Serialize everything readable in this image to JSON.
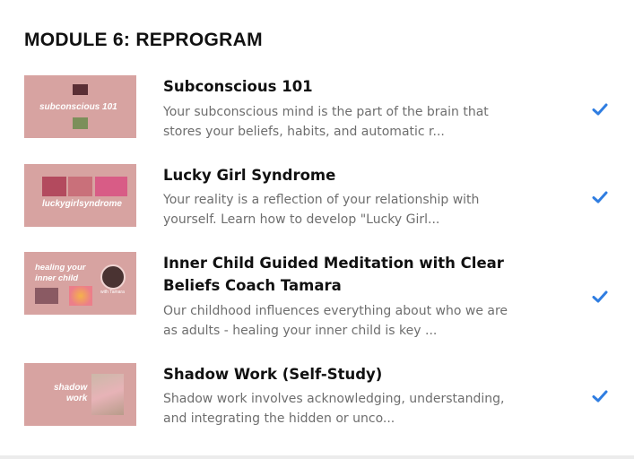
{
  "module": {
    "title": "MODULE 6: REPROGRAM"
  },
  "lessons": [
    {
      "title": "Subconscious 101",
      "description": "Your subconscious mind is the part of the brain that stores your beliefs, habits, and automatic r...",
      "thumbnail_caption": "subconscious 101",
      "completed": true
    },
    {
      "title": "Lucky Girl Syndrome",
      "description": "Your reality is a reflection of your relationship with yourself. Learn how to develop \"Lucky Girl...",
      "thumbnail_caption": "luckygirlsyndrome",
      "completed": true
    },
    {
      "title": "Inner Child Guided Meditation with Clear Beliefs Coach Tamara",
      "description": "Our childhood influences everything about who we are as adults - healing your inner child is key ...",
      "thumbnail_caption_line1": "healing your",
      "thumbnail_caption_line2": "inner child",
      "thumbnail_subcaption": "with Tamara",
      "completed": true
    },
    {
      "title": "Shadow Work (Self-Study)",
      "description": "Shadow work involves acknowledging, understanding, and integrating the hidden or unco...",
      "thumbnail_caption_line1": "shadow",
      "thumbnail_caption_line2": "work",
      "completed": true
    }
  ],
  "icons": {
    "check": "check-icon"
  },
  "colors": {
    "thumbnail_bg": "#d7a3a1",
    "check": "#2f7de1",
    "description": "#6e6e6e"
  }
}
